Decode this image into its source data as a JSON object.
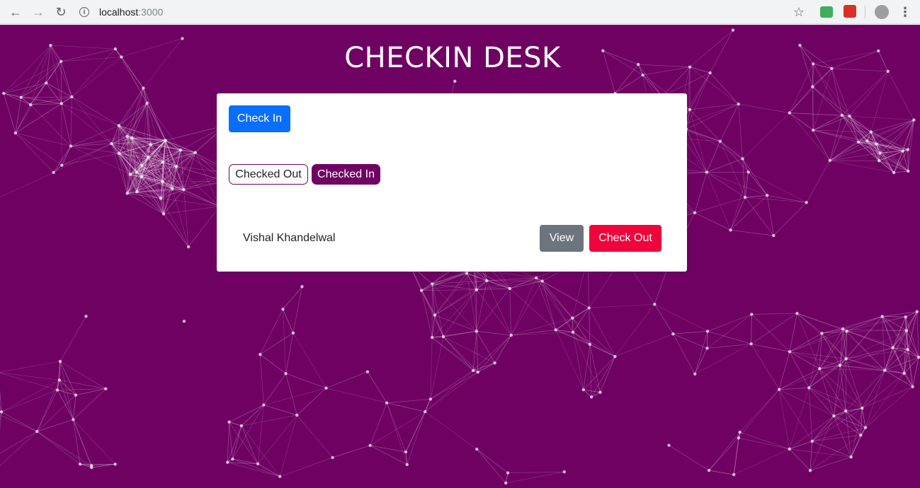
{
  "browser": {
    "url_host": "localhost",
    "url_port": ":3000",
    "icons": [
      "back-arrow-icon",
      "forward-arrow-icon",
      "reload-icon",
      "info-icon",
      "star-icon",
      "extension-icon",
      "extension-icon",
      "profile-avatar-icon",
      "menu-dots-icon"
    ]
  },
  "page": {
    "title": "CHECKIN DESK",
    "background_color": "#6f0163",
    "check_in_button": "Check In",
    "filters": {
      "checked_out": "Checked Out",
      "checked_in": "Checked In",
      "active": "checked_in"
    },
    "visitors": [
      {
        "name": "Vishal Khandelwal",
        "view_label": "View",
        "checkout_label": "Check Out"
      }
    ]
  },
  "colors": {
    "primary": "#0a6efd",
    "brand": "#6f0163",
    "secondary": "#6c757d",
    "danger": "#f0043c"
  }
}
